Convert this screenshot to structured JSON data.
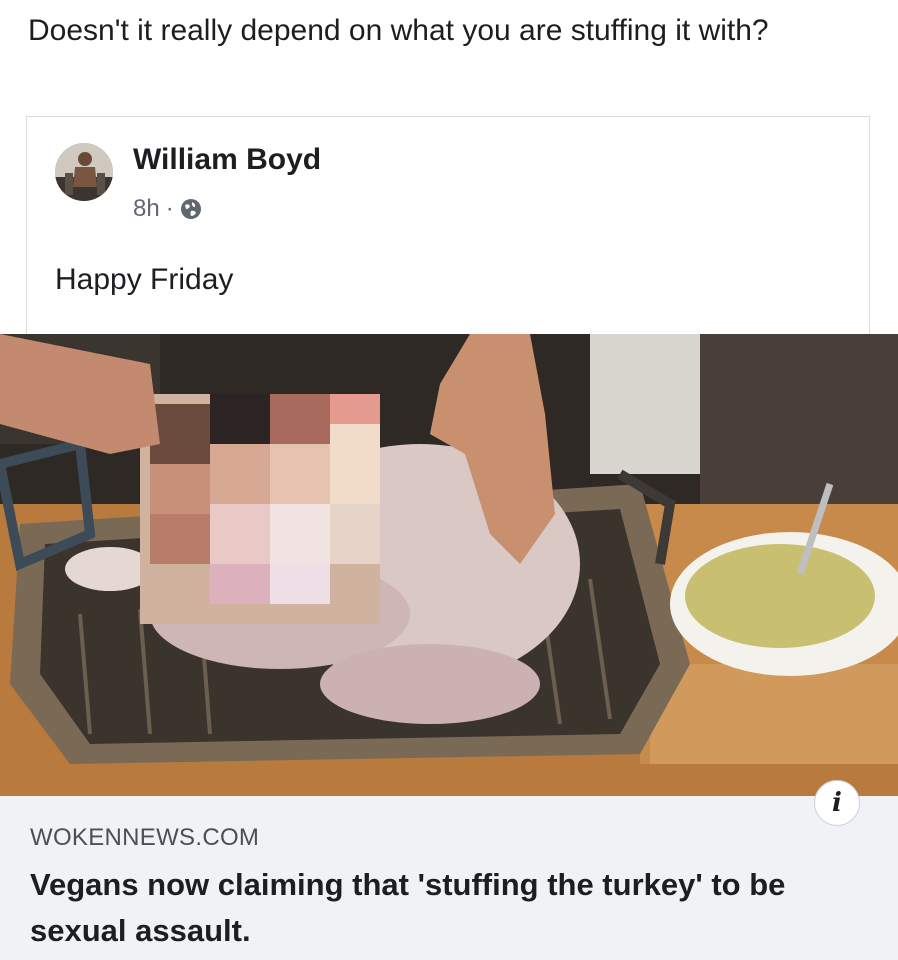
{
  "caption": "Doesn't it really depend on what you are stuffing it with?",
  "post": {
    "author": "William Boyd",
    "time": "8h",
    "separator": "·",
    "privacy_icon": "globe-icon",
    "text": "Happy Friday"
  },
  "link": {
    "info_icon": "i",
    "domain": "WOKENNEWS.COM",
    "title": "Vegans now claiming that 'stuffing the turkey' to be sexual assault."
  },
  "colors": {
    "text": "#1c1e21",
    "meta": "#606770",
    "preview_bg": "#f0f2f5",
    "border": "#dadde1"
  }
}
